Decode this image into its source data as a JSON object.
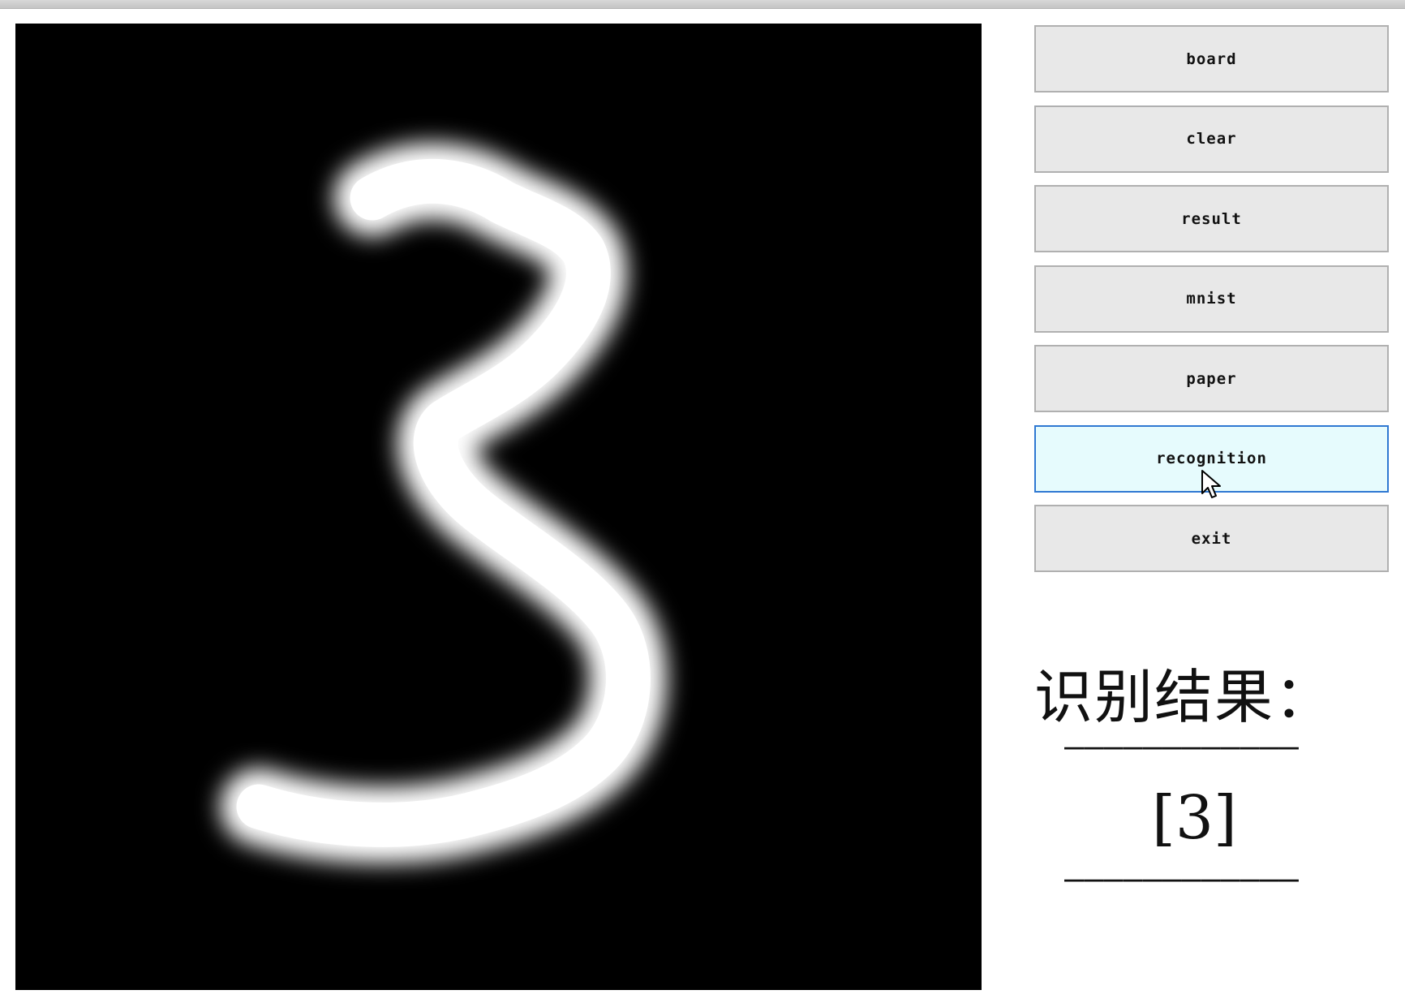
{
  "buttons": [
    {
      "name": "board-button",
      "label": "board",
      "active": false
    },
    {
      "name": "clear-button",
      "label": "clear",
      "active": false
    },
    {
      "name": "result-button",
      "label": "result",
      "active": false
    },
    {
      "name": "mnist-button",
      "label": "mnist",
      "active": false
    },
    {
      "name": "paper-button",
      "label": "paper",
      "active": false
    },
    {
      "name": "recognition-button",
      "label": "recognition",
      "active": true
    },
    {
      "name": "exit-button",
      "label": "exit",
      "active": false
    }
  ],
  "result": {
    "title": "识别结果：",
    "separator": "————————————",
    "value": "[3]"
  },
  "colors": {
    "canvas_background": "#000000",
    "stroke": "#ffffff",
    "button_face": "#e8e8e8",
    "button_active_face": "#e6fbfd",
    "button_active_border": "#2f78d2"
  },
  "icons": {
    "cursor": "arrow-cursor-icon"
  }
}
